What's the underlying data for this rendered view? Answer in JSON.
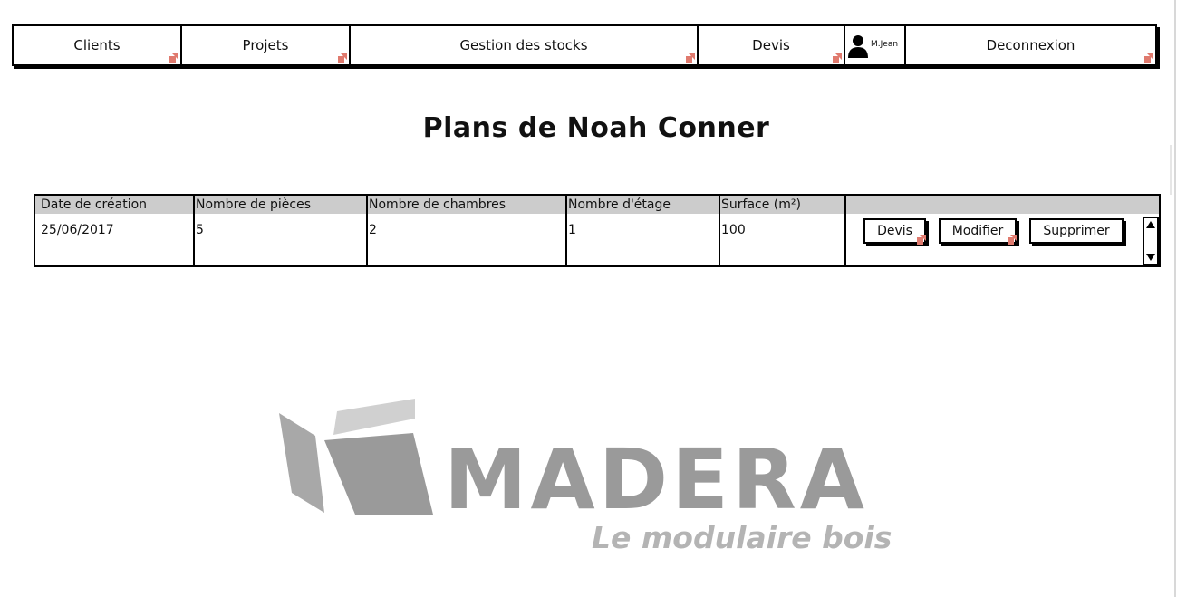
{
  "nav": {
    "items": [
      {
        "label": "Clients"
      },
      {
        "label": "Projets"
      },
      {
        "label": "Gestion des stocks"
      },
      {
        "label": "Devis"
      }
    ],
    "user_name": "M.Jean",
    "logout_label": "Deconnexion"
  },
  "page_title": "Plans de Noah Conner",
  "table": {
    "headers": [
      "Date de création",
      "Nombre de pièces",
      "Nombre de chambres",
      "Nombre d'étage",
      "Surface (m²)"
    ],
    "rows": [
      {
        "cells": [
          "25/06/2017",
          "5",
          "2",
          "1",
          "100"
        ]
      }
    ],
    "actions": {
      "quote_label": "Devis",
      "edit_label": "Modifier",
      "delete_label": "Supprimer"
    }
  },
  "logo": {
    "brand": "MADERA",
    "tagline": "Le modulaire bois",
    "color": "#9a9a9a"
  },
  "icons": {
    "link": "link-arrow-icon",
    "user": "user-icon",
    "scroll_up": "scroll-up-icon",
    "scroll_down": "scroll-down-icon"
  },
  "colors": {
    "link_arrow": "#e07a6e",
    "table_header_bg": "#cccccc"
  }
}
